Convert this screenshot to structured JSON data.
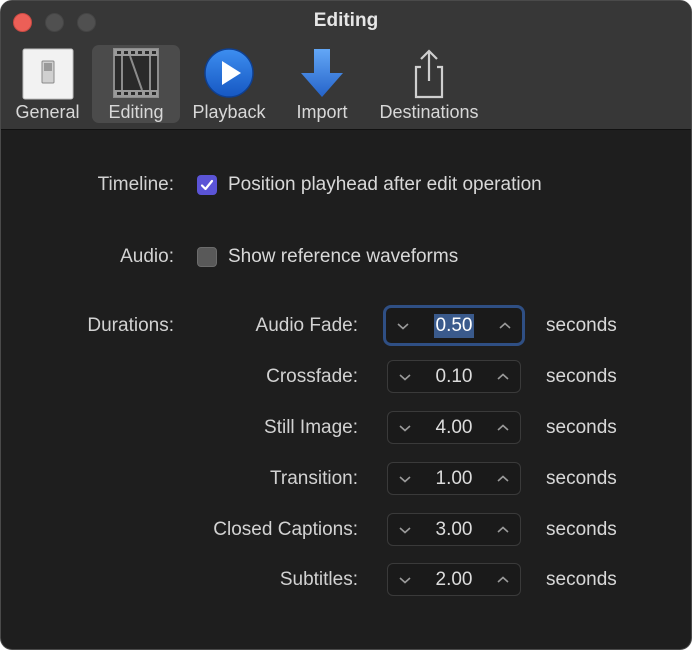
{
  "window": {
    "title": "Editing"
  },
  "toolbar": {
    "items": [
      {
        "label": "General",
        "icon": "switch-icon"
      },
      {
        "label": "Editing",
        "icon": "film-strip-icon",
        "selected": true
      },
      {
        "label": "Playback",
        "icon": "play-icon"
      },
      {
        "label": "Import",
        "icon": "import-arrow-icon"
      },
      {
        "label": "Destinations",
        "icon": "share-icon"
      }
    ]
  },
  "timeline": {
    "label": "Timeline:",
    "option": "Position playhead after edit operation",
    "checked": true
  },
  "audio": {
    "label": "Audio:",
    "option": "Show reference waveforms",
    "checked": false
  },
  "durations": {
    "label": "Durations:",
    "unit": "seconds",
    "items": [
      {
        "label": "Audio Fade:",
        "value": "0.50",
        "focused": true
      },
      {
        "label": "Crossfade:",
        "value": "0.10"
      },
      {
        "label": "Still Image:",
        "value": "4.00"
      },
      {
        "label": "Transition:",
        "value": "1.00"
      },
      {
        "label": "Closed Captions:",
        "value": "3.00"
      },
      {
        "label": "Subtitles:",
        "value": "2.00"
      }
    ]
  },
  "colors": {
    "accent": "#5b54d6",
    "focus_ring": "#2f4f84",
    "background": "#1e1e1e"
  }
}
